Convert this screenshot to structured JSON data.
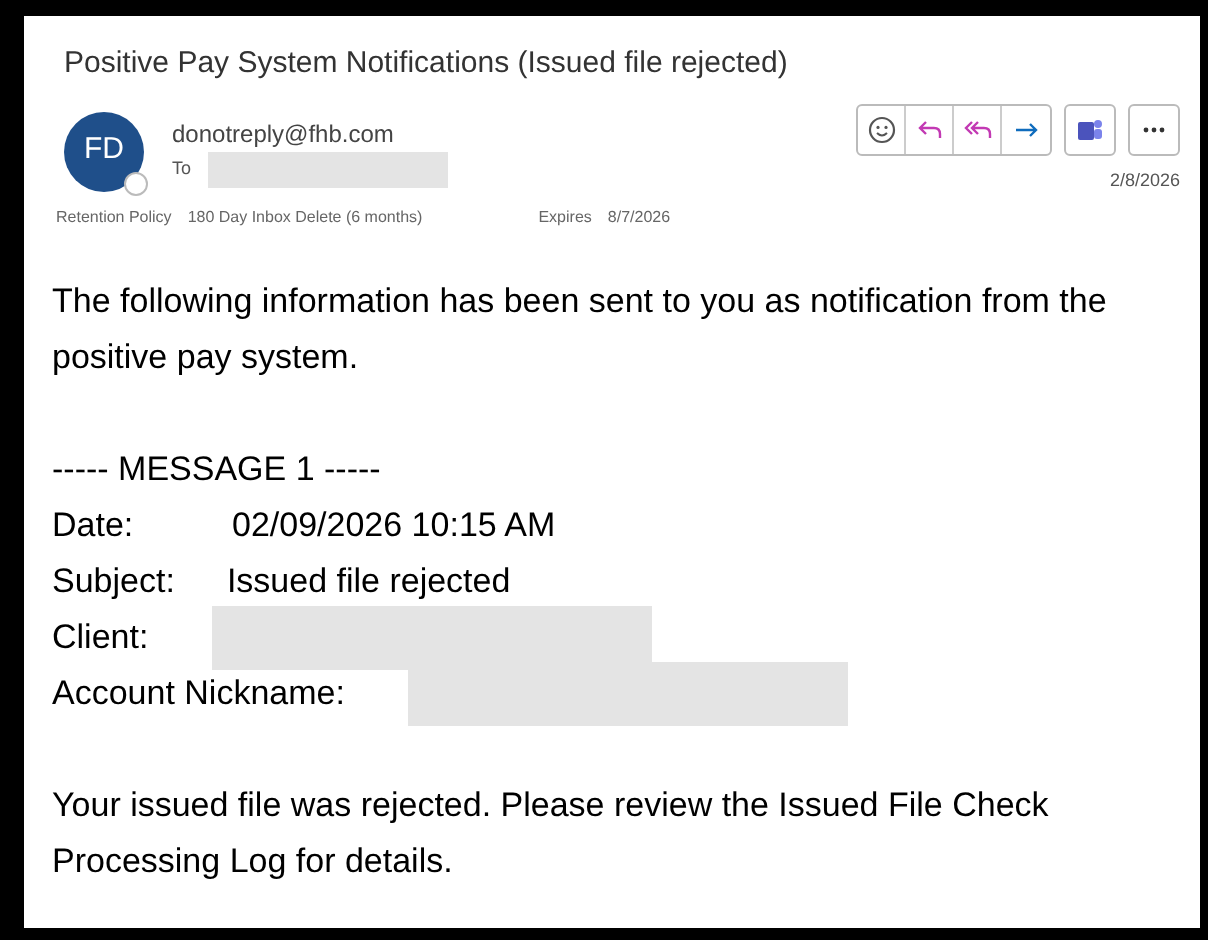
{
  "message": {
    "subject": "Positive Pay System Notifications (Issued file rejected)",
    "sender": {
      "initials": "FD",
      "email": "donotreply@fhb.com",
      "to_label": "To"
    },
    "date": "2/8/2026",
    "retention": {
      "label": "Retention Policy",
      "value": "180 Day Inbox Delete (6 months)",
      "expires_label": "Expires",
      "expires": "8/7/2026"
    }
  },
  "body": {
    "intro": "The following information has been sent to you as notification from the positive pay system.",
    "separator": "----- MESSAGE 1 -----",
    "fields": [
      {
        "label": "Date:",
        "kind": "text",
        "value": "02/09/2026 10:15 AM"
      },
      {
        "label": "Subject:",
        "kind": "text",
        "value": "Issued file rejected"
      },
      {
        "label": "Client:",
        "kind": "redacted"
      },
      {
        "label": "Account Nickname:",
        "kind": "redacted"
      }
    ],
    "closing": "Your issued file was rejected.  Please review the Issued File Check Processing Log for details."
  }
}
